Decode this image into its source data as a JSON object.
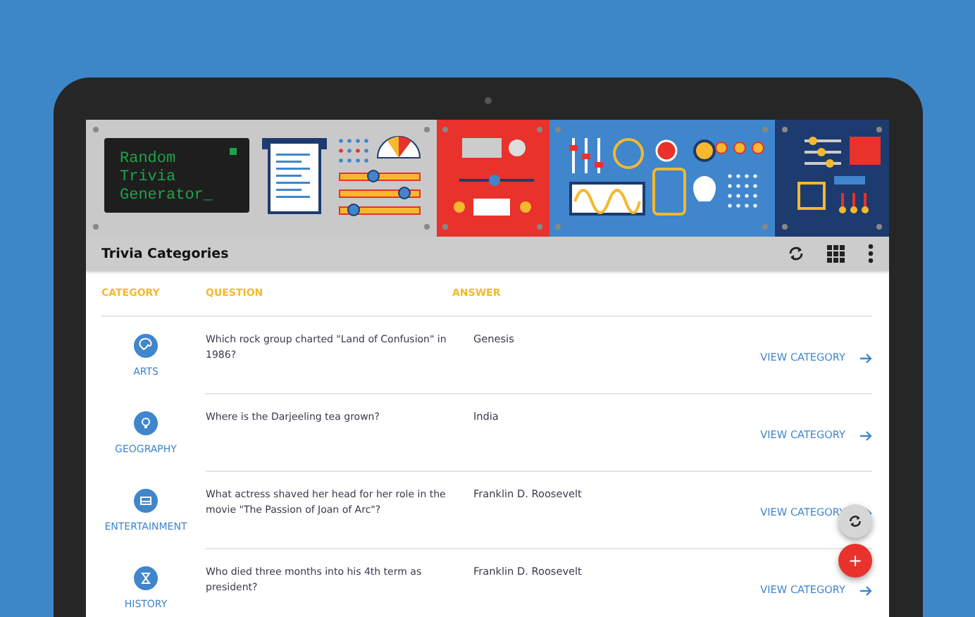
{
  "banner": {
    "screen_text": [
      "Random",
      "Trivia",
      "Generator_"
    ]
  },
  "toolbar": {
    "title": "Trivia Categories"
  },
  "table": {
    "columns": [
      "CATEGORY",
      "QUESTION",
      "ANSWER"
    ],
    "rows": [
      {
        "category": "ARTS",
        "question": "Which rock group charted \"Land of Confusion\" in 1986?",
        "answer": "Genesis",
        "link": "VIEW CATEGORY"
      },
      {
        "category": "GEOGRAPHY",
        "question": "Where is the Darjeeling tea grown?",
        "answer": "India",
        "link": "VIEW CATEGORY"
      },
      {
        "category": "ENTERTAINMENT",
        "question": "What actress shaved her head for her role in the movie \"The Passion of Joan of Arc\"?",
        "answer": "Franklin D. Roosevelt",
        "link": "VIEW CATEGORY"
      },
      {
        "category": "HISTORY",
        "question": "Who died three months into his 4th term as president?",
        "answer": "Franklin D. Roosevelt",
        "link": "VIEW CATEGORY"
      }
    ]
  },
  "fabs": [
    {
      "kind": "refresh"
    },
    {
      "kind": "add",
      "label": "+"
    }
  ]
}
